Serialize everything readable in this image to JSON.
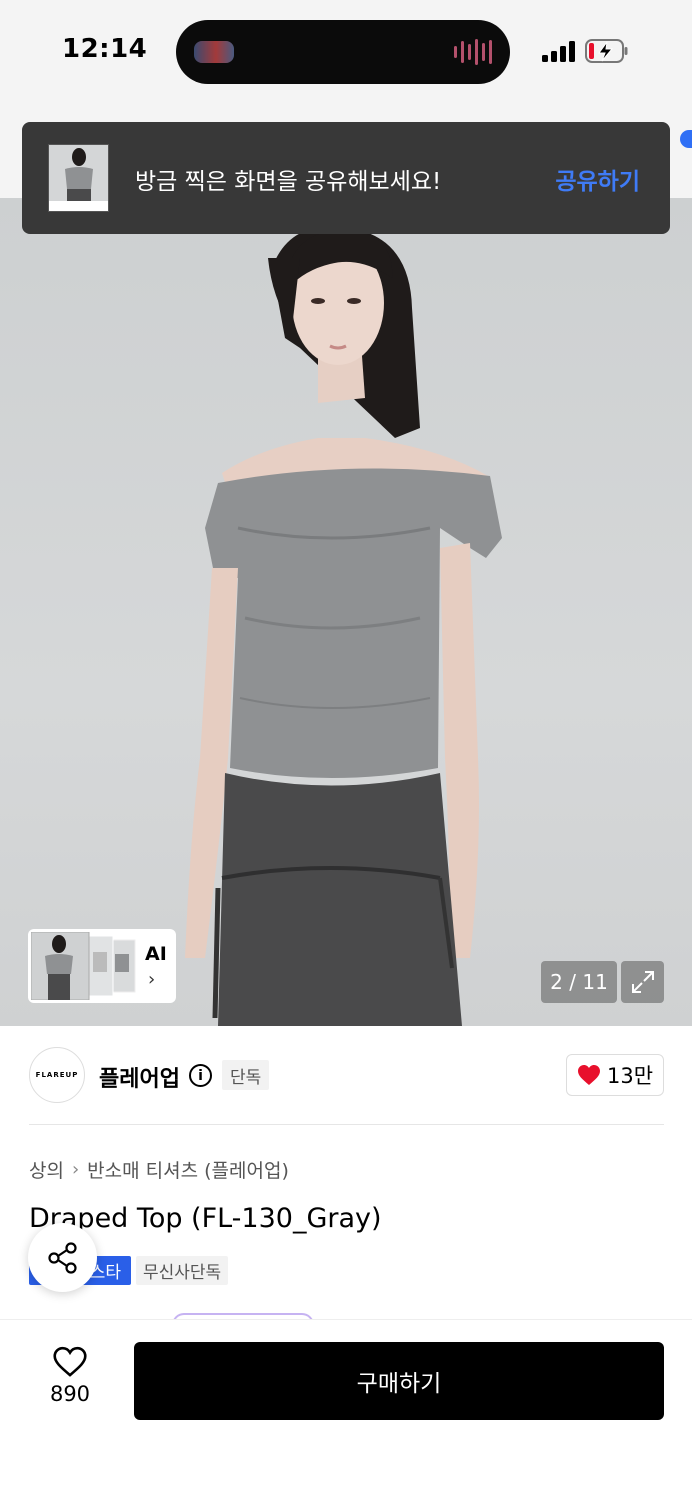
{
  "status_bar": {
    "time": "12:14"
  },
  "toast": {
    "message": "방금 찍은 화면을 공유해보세요!",
    "action": "공유하기"
  },
  "gallery": {
    "ai_label": "AI",
    "counter": "2 / 11"
  },
  "brand": {
    "logo_text": "FLAREUP",
    "name": "플레어업",
    "badge": "단독",
    "likes": "13만"
  },
  "product": {
    "breadcrumb": [
      "상의",
      "반소매 티셔츠 (플레어업)"
    ],
    "title": "Draped Top (FL-130_Gray)",
    "tags": [
      "스타",
      "무신사단독"
    ]
  },
  "bottom_bar": {
    "wish_count": "890",
    "buy_label": "구매하기"
  },
  "colors": {
    "accent_blue": "#2f6ff5",
    "toast_bg": "#383838",
    "heart_red": "#e8102c"
  }
}
